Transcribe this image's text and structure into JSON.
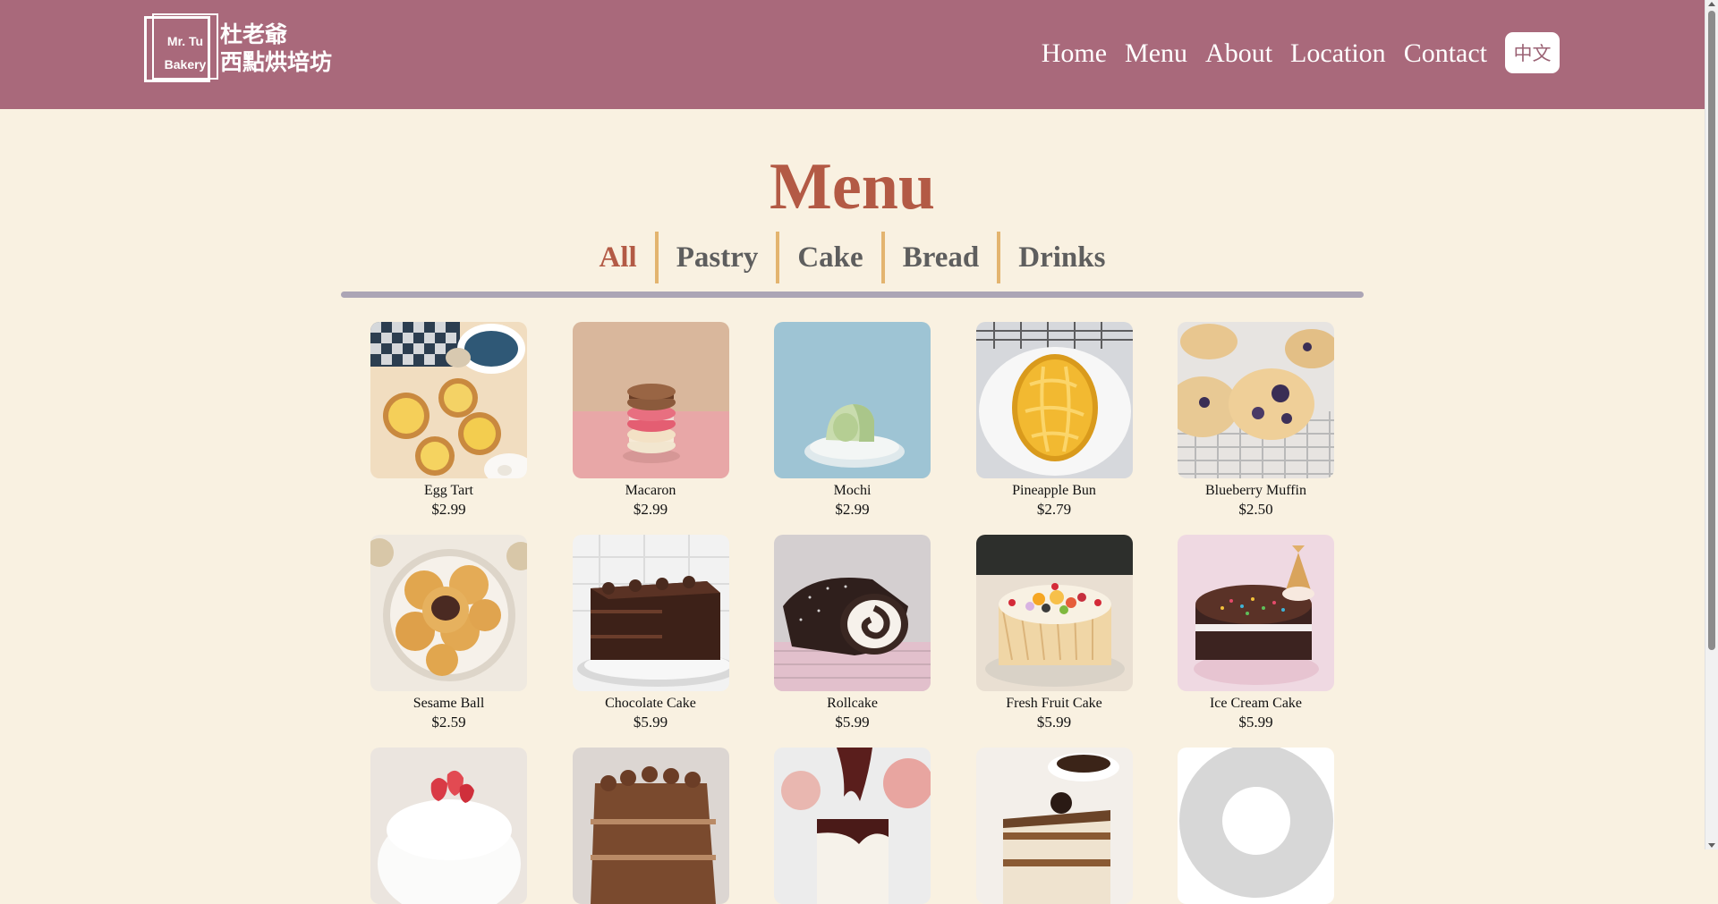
{
  "header": {
    "logo_en_line1": "Mr. Tu",
    "logo_en_line2": "Bakery",
    "logo_zh_line1": "杜老爺",
    "logo_zh_line2": "西點烘培坊",
    "nav": [
      "Home",
      "Menu",
      "About",
      "Location",
      "Contact"
    ],
    "lang_button": "中文"
  },
  "main": {
    "title": "Menu",
    "tabs": [
      "All",
      "Pastry",
      "Cake",
      "Bread",
      "Drinks"
    ],
    "active_tab": "All",
    "items": [
      {
        "name": "Egg Tart",
        "price": "$2.99",
        "image_icon": "egg-tart-image"
      },
      {
        "name": "Macaron",
        "price": "$2.99",
        "image_icon": "macaron-image"
      },
      {
        "name": "Mochi",
        "price": "$2.99",
        "image_icon": "mochi-image"
      },
      {
        "name": "Pineapple Bun",
        "price": "$2.79",
        "image_icon": "pineapple-bun-image"
      },
      {
        "name": "Blueberry Muffin",
        "price": "$2.50",
        "image_icon": "blueberry-muffin-image"
      },
      {
        "name": "Sesame Ball",
        "price": "$2.59",
        "image_icon": "sesame-ball-image"
      },
      {
        "name": "Chocolate Cake",
        "price": "$5.99",
        "image_icon": "chocolate-cake-image"
      },
      {
        "name": "Rollcake",
        "price": "$5.99",
        "image_icon": "rollcake-image"
      },
      {
        "name": "Fresh Fruit Cake",
        "price": "$5.99",
        "image_icon": "fresh-fruit-cake-image"
      },
      {
        "name": "Ice Cream Cake",
        "price": "$5.99",
        "image_icon": "ice-cream-cake-image"
      },
      {
        "image_icon": "cream-strawberry-cake-image"
      },
      {
        "image_icon": "chocolate-layer-cake-image"
      },
      {
        "image_icon": "chocolate-cheesecake-image"
      },
      {
        "image_icon": "tiramisu-image"
      },
      {
        "image_icon": "placeholder-image"
      }
    ]
  },
  "colors": {
    "header_bg": "#a9697b",
    "page_bg": "#f9f1e1",
    "accent": "#b35a45",
    "tab_separator": "#e3b46f",
    "tab_underline": "#aca5b5"
  }
}
